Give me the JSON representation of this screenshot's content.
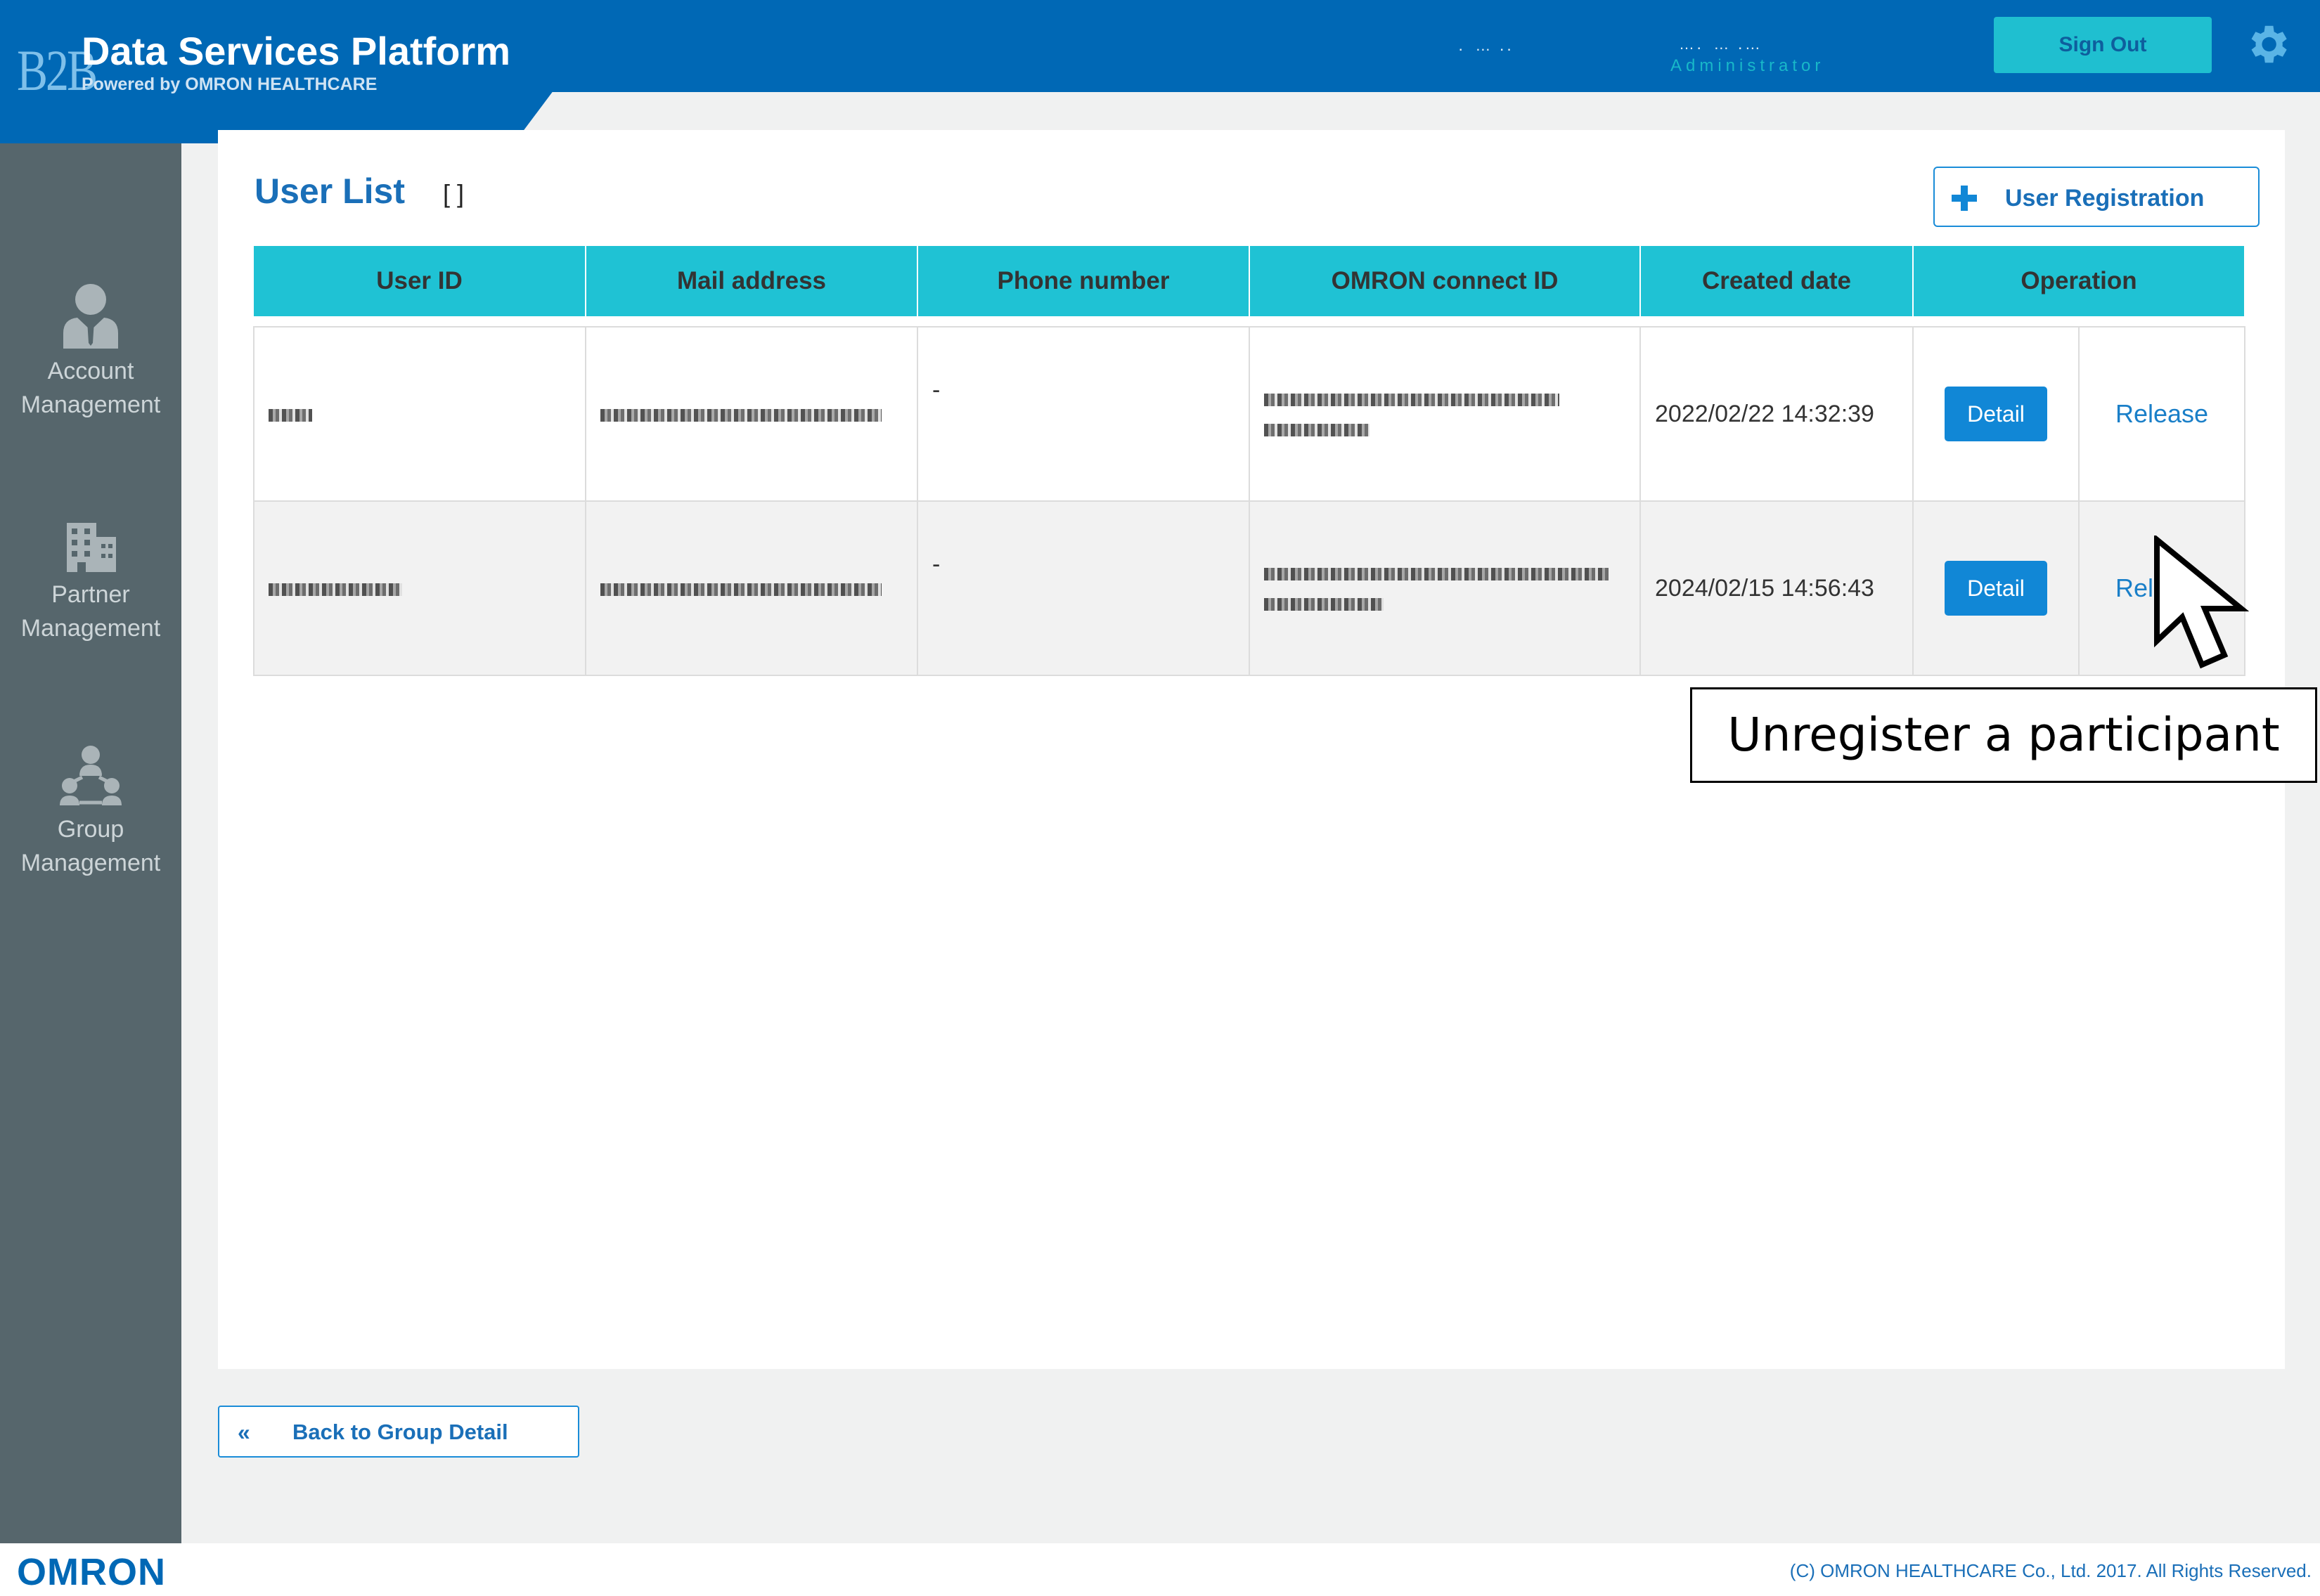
{
  "app": {
    "logo_text": "B2B",
    "title": "Data Services Platform",
    "subtitle": "Powered by OMRON HEALTHCARE"
  },
  "user": {
    "name": " ․ … ․․",
    "org": "…․ … ․…",
    "role": "Administrator"
  },
  "header": {
    "sign_out_label": "Sign Out",
    "settings_icon": "gear-icon"
  },
  "sidebar": {
    "items": [
      {
        "label": "Account Management",
        "icon": "person-icon"
      },
      {
        "label": "Partner Management",
        "icon": "building-icon"
      },
      {
        "label": "Group Management",
        "icon": "group-icon"
      }
    ]
  },
  "main": {
    "title": "User List",
    "group_name": "[                              ]",
    "register_label": "User Registration",
    "columns": [
      "User ID",
      "Mail address",
      "Phone number",
      "OMRON connect ID",
      "Created date",
      "Operation"
    ],
    "rows": [
      {
        "phone": "-",
        "created": "2022/02/22 14:32:39",
        "detail": "Detail",
        "release": "Release"
      },
      {
        "phone": "-",
        "created": "2024/02/15 14:56:43",
        "detail": "Detail",
        "release": "Release"
      }
    ],
    "back_label": "Back to Group Detail"
  },
  "annotation": {
    "text": "Unregister a participant"
  },
  "footer": {
    "brand": "OMRON",
    "copyright": "(C) OMRON HEALTHCARE Co., Ltd. 2017. All Rights Reserved."
  },
  "colors": {
    "brand_blue": "#0068b5",
    "accent_cyan": "#1fc2d4",
    "sidebar": "#56666c",
    "button_blue": "#1187d6"
  }
}
